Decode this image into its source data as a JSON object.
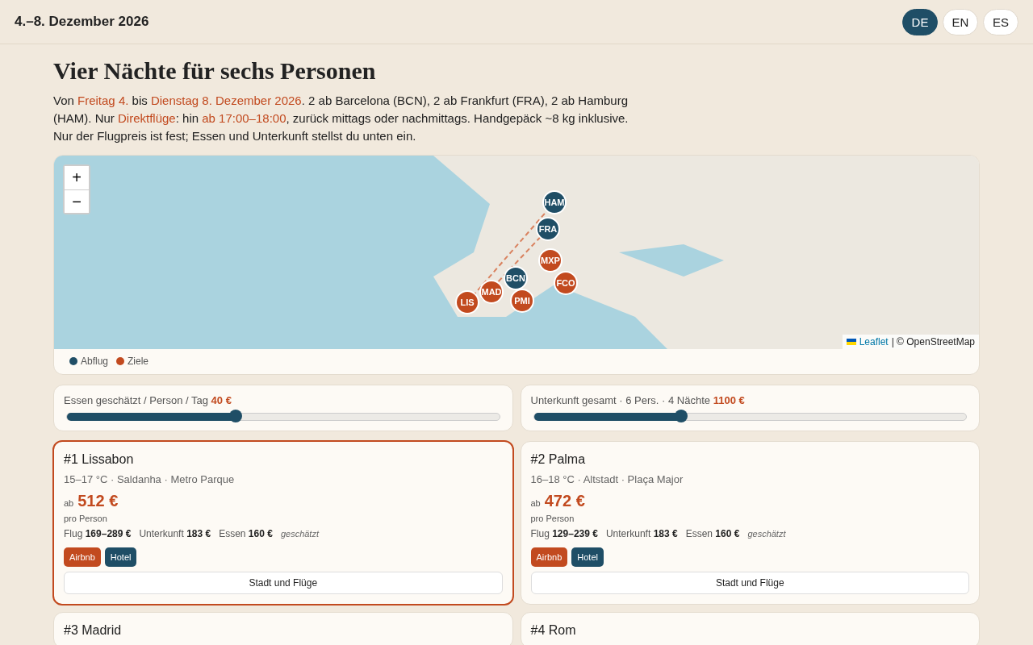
{
  "header": {
    "title": "4.–8. Dezember 2026",
    "languages": [
      {
        "label": "DE",
        "selected": true
      },
      {
        "label": "EN",
        "selected": false
      },
      {
        "label": "ES",
        "selected": false
      }
    ]
  },
  "heading": "Vier Nächte für sechs Personen",
  "intro": [
    {
      "text": "Von ",
      "highlight": false
    },
    {
      "text": "Freitag 4.",
      "highlight": true
    },
    {
      "text": " bis ",
      "highlight": false
    },
    {
      "text": "Dienstag 8. Dezember 2026",
      "highlight": true
    },
    {
      "text": ". 2 ab Barcelona (BCN), 2 ab Frankfurt (FRA), 2 ab Hamburg (HAM). Nur ",
      "highlight": false
    },
    {
      "text": "Direktflüge",
      "highlight": true
    },
    {
      "text": ": hin ",
      "highlight": false
    },
    {
      "text": "ab 17:00–18:00",
      "highlight": true
    },
    {
      "text": ", zurück mittags oder nachmittags. Handgepäck ~8 kg inklusive. Nur der Flugpreis ist fest; Essen und Unterkunft stellst du unten ein.",
      "highlight": false
    }
  ],
  "map": {
    "zoom_in": "+",
    "zoom_out": "−",
    "attribution_link": "Leaflet",
    "attribution_text": "| © OpenStreetMap",
    "markers": [
      {
        "code": "HAM",
        "kind": "departure"
      },
      {
        "code": "FRA",
        "kind": "departure"
      },
      {
        "code": "MXP",
        "kind": "destination"
      },
      {
        "code": "FCO",
        "kind": "destination"
      },
      {
        "code": "BCN",
        "kind": "departure"
      },
      {
        "code": "PMI",
        "kind": "destination"
      },
      {
        "code": "MAD",
        "kind": "destination"
      },
      {
        "code": "LIS",
        "kind": "destination"
      }
    ],
    "legend": [
      {
        "label": "Abflug",
        "color": "#1f4e66"
      },
      {
        "label": "Ziele",
        "color": "#c24a1f"
      }
    ]
  },
  "sliders": [
    {
      "label": "Essen geschätzt / Person / Tag",
      "value": "40 €",
      "level": 0.39
    },
    {
      "label": "Unterkunft gesamt · 6 Pers. · 4 Nächte",
      "value": "1100 €",
      "level": 0.34
    }
  ],
  "cards": [
    {
      "title": "#1 Lissabon",
      "selected": true,
      "details": "15–17 °C · Saldanha · Metro Parque",
      "price_prefix": "ab",
      "price": "512 €",
      "price_note": "pro Person",
      "costs": [
        {
          "label": "Flug",
          "value": "169–289 €"
        },
        {
          "label": "Unterkunft",
          "value": "183 €"
        },
        {
          "label": "Essen",
          "value": "160 €"
        }
      ],
      "estimate_note": "geschätzt",
      "tags": [
        {
          "label": "Airbnb",
          "kind": "airbnb"
        },
        {
          "label": "Hotel",
          "kind": "hotel"
        }
      ],
      "button": "Stadt und Flüge"
    },
    {
      "title": "#2 Palma",
      "selected": false,
      "details": "16–18 °C · Altstadt · Plaça Major",
      "price_prefix": "ab",
      "price": "472 €",
      "price_note": "pro Person",
      "costs": [
        {
          "label": "Flug",
          "value": "129–239 €"
        },
        {
          "label": "Unterkunft",
          "value": "183 €"
        },
        {
          "label": "Essen",
          "value": "160 €"
        }
      ],
      "estimate_note": "geschätzt",
      "tags": [
        {
          "label": "Airbnb",
          "kind": "airbnb"
        },
        {
          "label": "Hotel",
          "kind": "hotel"
        }
      ],
      "button": "Stadt und Flüge"
    },
    {
      "title": "#3 Madrid",
      "selected": false
    },
    {
      "title": "#4 Rom",
      "selected": false
    }
  ]
}
